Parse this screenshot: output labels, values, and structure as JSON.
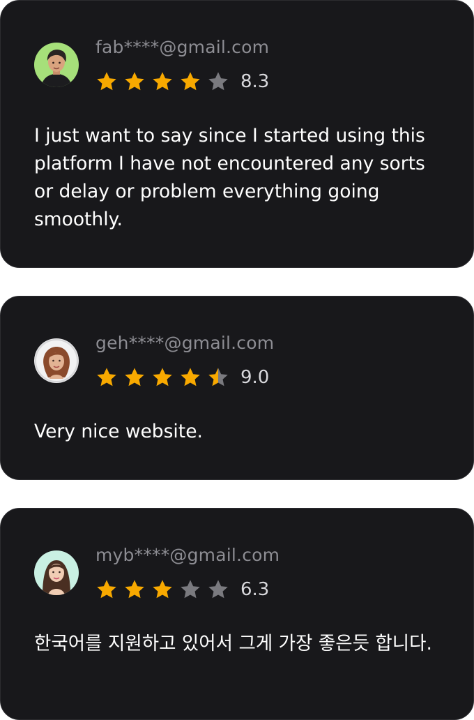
{
  "colors": {
    "card_background": "#18181b",
    "star_filled": "#f8a900",
    "star_empty": "#7a7a7f",
    "email_text": "#8d8d93",
    "review_text": "#ffffff"
  },
  "reviews": [
    {
      "avatar_icon": "user-avatar-green-background",
      "email": "fab****@gmail.com",
      "stars": 4,
      "score": "8.3",
      "text": "I just want to say since I started using this platform I have not encountered any sorts or delay or problem everything going smoothly."
    },
    {
      "avatar_icon": "user-avatar-gray-background",
      "email": "geh****@gmail.com",
      "stars": 4.5,
      "score": "9.0",
      "text": "Very nice website."
    },
    {
      "avatar_icon": "user-avatar-mint-background",
      "email": "myb****@gmail.com",
      "stars": 3,
      "score": "6.3",
      "text": "한국어를 지원하고 있어서 그게 가장 좋은듯 합니다."
    }
  ]
}
